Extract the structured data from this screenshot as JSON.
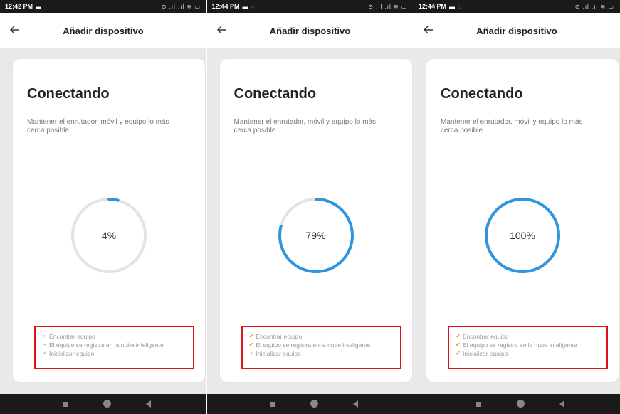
{
  "screens": [
    {
      "status_time": "12:42 PM",
      "notif_icons": "▬",
      "system_icons": "⊙ .ıl .ıl ≋ ▭",
      "title": "Añadir dispositivo",
      "heading": "Conectando",
      "description": "Mantener el enrutador, móvil y equipo lo más cerca posible",
      "progress_label": "4%",
      "progress": 0.04,
      "steps": [
        {
          "label": "Encontrar equipo",
          "done": false
        },
        {
          "label": "El equipo se registra en la nube inteligente",
          "done": false
        },
        {
          "label": "Inicializar equipo",
          "done": false
        }
      ]
    },
    {
      "status_time": "12:44 PM",
      "notif_icons": "▬ ◌",
      "system_icons": "⊙ .ıl .ıl ≋ ▭",
      "title": "Añadir dispositivo",
      "heading": "Conectando",
      "description": "Mantener el enrutador, móvil y equipo lo más cerca posible",
      "progress_label": "79%",
      "progress": 0.79,
      "steps": [
        {
          "label": "Encontrar equipo",
          "done": true
        },
        {
          "label": "El equipo se registra en la nube inteligente",
          "done": true
        },
        {
          "label": "Inicializar equipo",
          "done": false
        }
      ]
    },
    {
      "status_time": "12:44 PM",
      "notif_icons": "▬ ◌",
      "system_icons": "⊙ .ıl .ıl ≋ ▭",
      "title": "Añadir dispositivo",
      "heading": "Conectando",
      "description": "Mantener el enrutador, móvil y equipo lo más cerca posible",
      "progress_label": "100%",
      "progress": 1.0,
      "steps": [
        {
          "label": "Encontrar equipo",
          "done": true
        },
        {
          "label": "El equipo se registra en la nube inteligente",
          "done": true
        },
        {
          "label": "Inicializar equipo",
          "done": true
        }
      ]
    }
  ],
  "colors": {
    "progress": "#2f95dd",
    "track": "#e3e3e3",
    "highlight_box": "#e0111b",
    "check": "#e0a010"
  }
}
